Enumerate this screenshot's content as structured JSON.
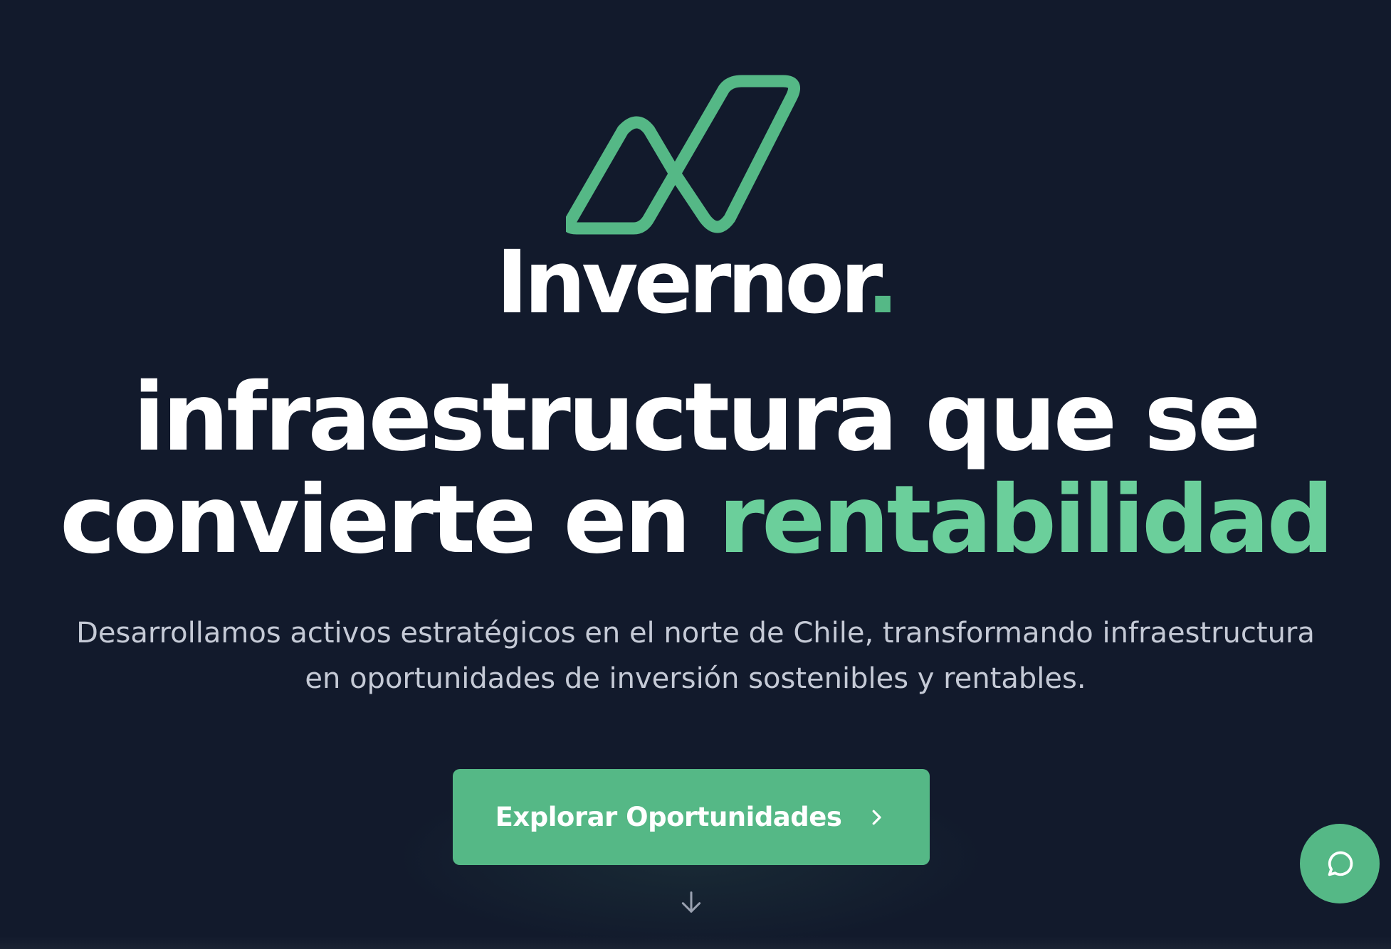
{
  "brand": {
    "name": "Invernor",
    "dot": ".",
    "accent_color": "#55b886",
    "background_color": "#121a2c"
  },
  "hero": {
    "headline_line1": "infraestructura que se",
    "headline_line2_prefix": "convierte en ",
    "headline_highlight": "rentabilidad",
    "subtitle_line1": "Desarrollamos activos estratégicos en el norte de Chile, transformando infraestructura",
    "subtitle_line2": "en oportunidades de inversión sostenibles y rentables.",
    "cta_label": "Explorar Oportunidades"
  },
  "icons": {
    "logo": "invernor-logo-icon",
    "cta": "chevron-right-icon",
    "scroll": "arrow-down-icon",
    "chat": "chat-bubble-icon"
  }
}
